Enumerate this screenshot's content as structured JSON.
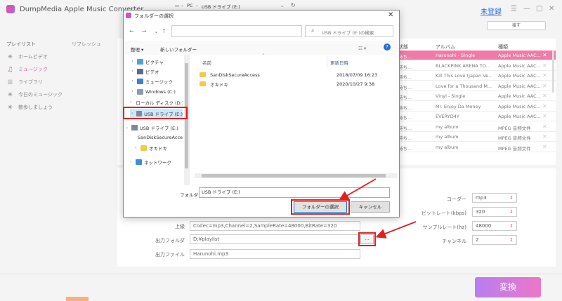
{
  "app": {
    "title": "DumpMedia Apple Music Converter",
    "register_link": "未登録",
    "window_controls": [
      "☰",
      "—",
      "□",
      "✕"
    ],
    "sub_button": "接す"
  },
  "sidebar": {
    "header": "プレイリスト",
    "refresh": "リフレッシュ",
    "items": [
      {
        "label": "ホームビデオ",
        "icon": "gear-icon"
      },
      {
        "label": "ミュージック",
        "icon": "music-note-icon"
      },
      {
        "label": "ライブラリ",
        "icon": "list-icon"
      },
      {
        "label": "今日のミュージック",
        "icon": "gear-icon"
      },
      {
        "label": "散歩しましょう",
        "icon": "gear-icon"
      }
    ]
  },
  "track_table": {
    "headers": [
      "状態",
      "アルバム",
      "種類"
    ],
    "rows": [
      {
        "status": "待ち...",
        "album": "Harunohi - Single",
        "kind": "Apple Music AAC...",
        "selected": true
      },
      {
        "status": "待ち...",
        "album": "BLACKPINK ARENA TO...",
        "kind": "Apple Music AAC..."
      },
      {
        "status": "待ち...",
        "album": "Kill This Love (Japan Ve...",
        "kind": "Apple Music AAC..."
      },
      {
        "status": "待ち...",
        "album": "Love for a Thousand M...",
        "kind": "Apple Music AAC..."
      },
      {
        "status": "待ち...",
        "album": "Vinyl - Single",
        "kind": "Apple Music AAC..."
      },
      {
        "status": "待ち...",
        "album": "Mr. Enjoy Da Money",
        "kind": "Apple Music AAC..."
      },
      {
        "status": "待ち...",
        "album": "EVERYD4Y",
        "kind": "Apple Music AAC..."
      },
      {
        "status": "待ち...",
        "album": "my album",
        "kind": "MPEG 音频文件"
      },
      {
        "status": "待ち...",
        "album": "my album",
        "kind": "MPEG 音频文件"
      },
      {
        "status": "待ち...",
        "album": "my album",
        "kind": "MPEG 音频文件"
      }
    ]
  },
  "output": {
    "advanced_label": "上級",
    "advanced_value": "Codec=mp3,Channel=2,SampleRate=48000,BitRate=320",
    "folder_label": "出力フォルダ",
    "folder_value": "D:¥playlist",
    "browse_label": "...",
    "file_label": "出力ファイル",
    "file_value": "Harunohi.mp3"
  },
  "settings": [
    {
      "label": "コーダー",
      "value": "mp3"
    },
    {
      "label": "ビットレート(kbps)",
      "value": "320"
    },
    {
      "label": "サンプルレート(hz)",
      "value": "48000"
    },
    {
      "label": "チャンネル",
      "value": "2"
    }
  ],
  "convert_button": "変換",
  "dialog": {
    "title": "フォルダーの選択",
    "close": "✕",
    "nav": {
      "back": "←",
      "forward": "→",
      "recent": "⌄",
      "up": "↑"
    },
    "address": {
      "pc": "PC",
      "sep": "›",
      "drive": "USB ドライブ (E:)",
      "dropdown": "⌄",
      "refresh": "↻"
    },
    "search_placeholder": "USB ドライブ (E:)の検索",
    "toolbar": {
      "organize": "整理 ▾",
      "new_folder": "新しいフォルダー",
      "view": "☷ ▾",
      "help": "?"
    },
    "tree": [
      {
        "label": "ピクチャ",
        "icon": "pictures-icon",
        "expander": "›"
      },
      {
        "label": "ビデオ",
        "icon": "videos-icon",
        "expander": "›"
      },
      {
        "label": "ミュージック",
        "icon": "music-icon",
        "expander": "›"
      },
      {
        "label": "Windows (C:)",
        "icon": "drive-icon",
        "expander": "›"
      },
      {
        "label": "ローカル ディスク (D:)",
        "icon": "drive-icon",
        "expander": "›"
      },
      {
        "label": "USB ドライブ (E:)",
        "icon": "usb-drive-icon",
        "expander": "›",
        "selected": true
      },
      {
        "label": "USB ドライブ (E:)",
        "icon": "usb-drive-icon",
        "expander": "⌄"
      },
      {
        "label": "SanDiskSecureAccess",
        "icon": "folder-icon",
        "expander": ""
      },
      {
        "label": "オキドキ",
        "icon": "folder-icon",
        "expander": "›"
      },
      {
        "label": "ネットワーク",
        "icon": "network-icon",
        "expander": "›"
      }
    ],
    "columns": {
      "name": "名前",
      "modified": "更新日時"
    },
    "files": [
      {
        "name": "SanDiskSecureAccess",
        "modified": "2018/07/09 16:23"
      },
      {
        "name": "オキドキ",
        "modified": "2020/10/27 9:38"
      }
    ],
    "folder_field_label": "フォルダー:",
    "folder_field_value": "USB ドライブ (E:)",
    "select_button": "フォルダーの選択",
    "cancel_button": "キャンセル"
  },
  "colors": {
    "accent_pink": "#f07aa8",
    "highlight_red": "#e02020",
    "selection_blue": "#cce8ff"
  }
}
